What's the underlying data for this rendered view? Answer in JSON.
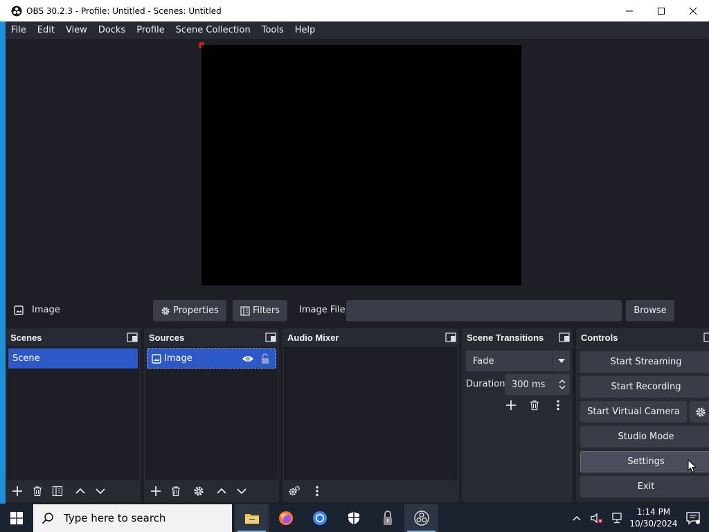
{
  "window": {
    "title": "OBS 30.2.3 - Profile: Untitled - Scenes: Untitled"
  },
  "menubar": {
    "items": [
      "File",
      "Edit",
      "View",
      "Docks",
      "Profile",
      "Scene Collection",
      "Tools",
      "Help"
    ]
  },
  "context": {
    "source_name": "Image",
    "properties_label": "Properties",
    "filters_label": "Filters",
    "field_label": "Image File",
    "browse_label": "Browse"
  },
  "scenes": {
    "title": "Scenes",
    "items": [
      "Scene"
    ]
  },
  "sources": {
    "title": "Sources",
    "items": [
      "Image"
    ]
  },
  "audio_mixer": {
    "title": "Audio Mixer"
  },
  "transitions": {
    "title": "Scene Transitions",
    "selected": "Fade",
    "duration_label": "Duration",
    "duration_value": "300 ms"
  },
  "controls": {
    "title": "Controls",
    "start_streaming": "Start Streaming",
    "start_recording": "Start Recording",
    "start_virtual_camera": "Start Virtual Camera",
    "studio_mode": "Studio Mode",
    "settings": "Settings",
    "exit": "Exit"
  },
  "taskbar": {
    "search_placeholder": "Type here to search",
    "time": "1:14 PM",
    "date": "10/30/2024"
  },
  "colors": {
    "accent_selected": "#2c58c8",
    "panel": "#272a33",
    "background": "#1e1f26",
    "button": "#3a3d48"
  }
}
